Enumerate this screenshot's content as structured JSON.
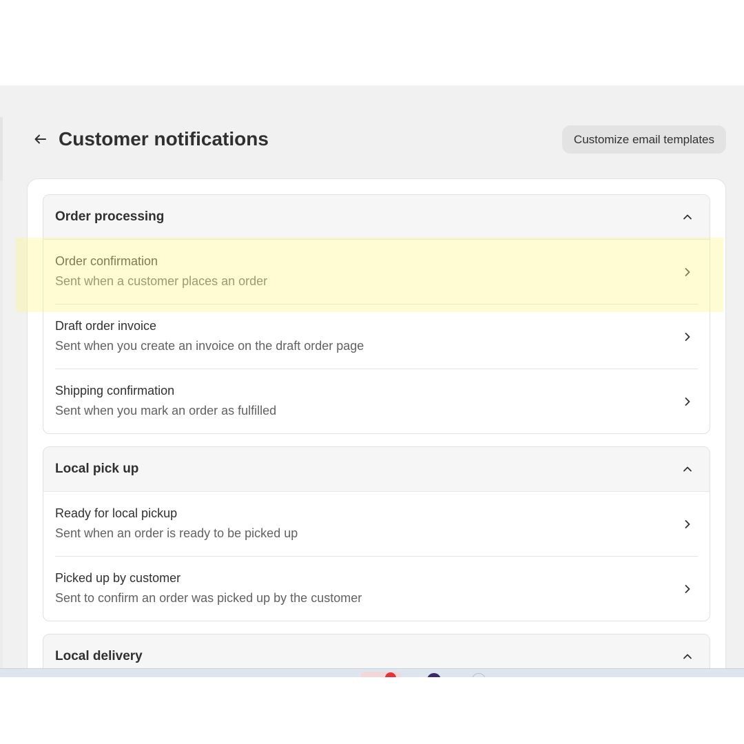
{
  "header": {
    "back_icon": "arrow-left-icon",
    "title": "Customer notifications",
    "customize_button_label": "Customize email templates"
  },
  "sections": [
    {
      "title": "Order processing",
      "collapse_icon": "chevron-up-icon",
      "items": [
        {
          "title": "Order confirmation",
          "description": "Sent when a customer places an order",
          "icon": "chevron-right-icon",
          "highlighted": true
        },
        {
          "title": "Draft order invoice",
          "description": "Sent when you create an invoice on the draft order page",
          "icon": "chevron-right-icon"
        },
        {
          "title": "Shipping confirmation",
          "description": "Sent when you mark an order as fulfilled",
          "icon": "chevron-right-icon"
        }
      ]
    },
    {
      "title": "Local pick up",
      "collapse_icon": "chevron-up-icon",
      "items": [
        {
          "title": "Ready for local pickup",
          "description": "Sent when an order is ready to be picked up",
          "icon": "chevron-right-icon"
        },
        {
          "title": "Picked up by customer",
          "description": "Sent to confirm an order was picked up by the customer",
          "icon": "chevron-right-icon"
        }
      ]
    },
    {
      "title": "Local delivery",
      "collapse_icon": "chevron-up-icon",
      "items": []
    }
  ],
  "colors": {
    "page_background": "#f1f1f1",
    "card_background": "#ffffff",
    "section_header_background": "#f6f6f6",
    "button_background": "#e3e3e3",
    "highlight": "#fff68c"
  }
}
